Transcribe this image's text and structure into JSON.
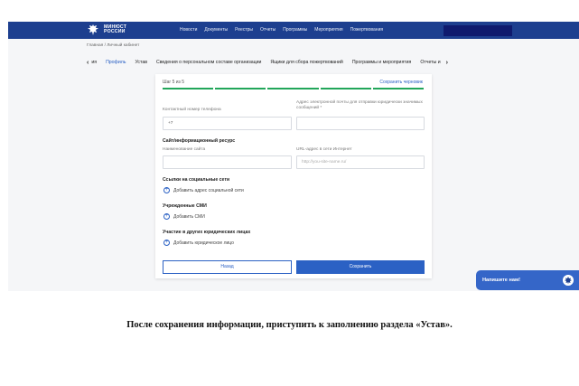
{
  "header": {
    "logo_line1": "МИНЮСТ",
    "logo_line2": "РОССИИ",
    "nav": [
      "Новости",
      "Документы",
      "Реестры",
      "Отчеты",
      "Программы",
      "Мероприятия",
      "Пожертвования"
    ]
  },
  "breadcrumb": "Главная / Личный кабинет",
  "tabs": {
    "first": "ия",
    "items": [
      "Профиль",
      "Устав",
      "Сведения о персональном составе организации",
      "Ящики для сбора пожертвований",
      "Программы и мероприятия",
      "Отчеты и"
    ],
    "active_index": 0
  },
  "form": {
    "step": "Шаг 5 из 5",
    "save_draft": "Сохранить черновик",
    "progress": {
      "total": 5,
      "completed": 5
    },
    "contact_phone_label": "Контактный номер телефона",
    "contact_phone_value": "+7",
    "email_label": "Адрес электронной почты для отправки юридически значимых сообщений *",
    "email_value": "",
    "site_section": "Сайт/информационный ресурс",
    "site_name_label": "Наименование сайта",
    "site_name_value": "",
    "site_url_label": "URL-адрес в сети Интернет",
    "site_url_placeholder": "http://you-site-name.ru/",
    "social_section": "Ссылки на социальные сети",
    "social_add": "Добавить адрес социальной сети",
    "media_section": "Учрежденные СМИ",
    "media_add": "Добавить СМИ",
    "legal_section": "Участие в других юридических лицах",
    "legal_add": "Добавить юридическое лицо",
    "back_label": "Назад",
    "save_label": "Сохранить"
  },
  "chat": {
    "label": "Напишите нам!"
  },
  "caption": "После сохранения информации, приступить к заполнению раздела «Устав».",
  "colors": {
    "header": "#1d3f8f",
    "accent": "#2b61c4",
    "progress": "#22a65a"
  }
}
